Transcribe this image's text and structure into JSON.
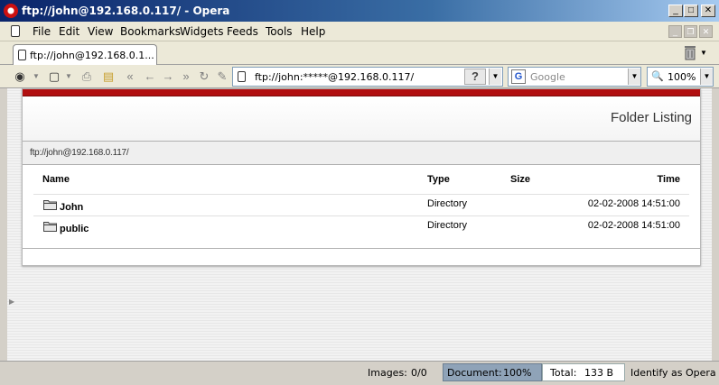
{
  "window": {
    "title": "ftp://john@192.168.0.117/ - Opera",
    "minimize": "_",
    "maximize": "□",
    "close": "✕"
  },
  "menu": [
    "File",
    "Edit",
    "View",
    "Bookmarks",
    "Widgets",
    "Feeds",
    "Tools",
    "Help"
  ],
  "tabs": [
    {
      "label": "ftp://john@192.168.0.1..."
    }
  ],
  "address": {
    "value": "ftp://john:*****@192.168.0.117/",
    "help": "?"
  },
  "search": {
    "engine": "G",
    "placeholder": "Google"
  },
  "zoom": {
    "value": "100%"
  },
  "page": {
    "heading": "Folder Listing",
    "path": "ftp://john@192.168.0.117/",
    "columns": {
      "name": "Name",
      "type": "Type",
      "size": "Size",
      "time": "Time"
    },
    "rows": [
      {
        "name": "John",
        "type": "Directory",
        "size": "",
        "time": "02-02-2008 14:51:00"
      },
      {
        "name": "public",
        "type": "Directory",
        "size": "",
        "time": "02-02-2008 14:51:00"
      }
    ]
  },
  "status": {
    "images_label": "Images:",
    "images_value": "0/0",
    "document_label": "Document:",
    "document_value": "100%",
    "total_label": "Total:",
    "total_value": "133 B",
    "identify": "Identify as Opera"
  },
  "colors": {
    "accent_red": "#b10f10",
    "titlebar_start": "#0a246a",
    "titlebar_end": "#a6caf0"
  },
  "icons": [
    "opera-icon",
    "page-icon",
    "trash-icon",
    "folder-icon",
    "google-icon",
    "zoom-icon"
  ]
}
